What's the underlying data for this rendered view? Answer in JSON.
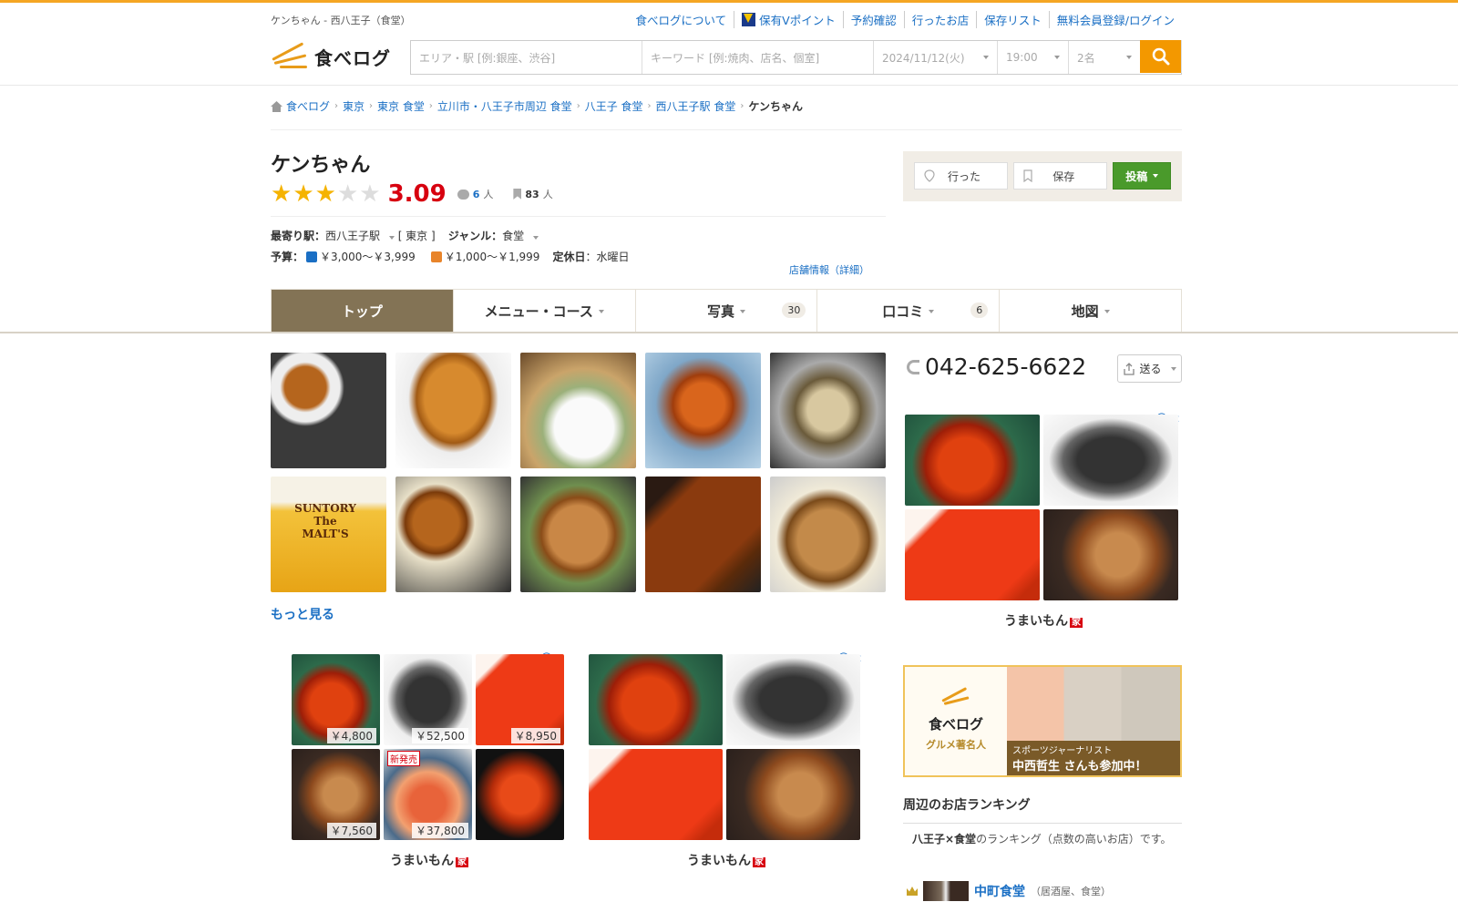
{
  "header": {
    "shop_path": "ケンちゃん - 西八王子（食堂）",
    "links": [
      "食べログについて",
      "保有Vポイント",
      "予約確認",
      "行ったお店",
      "保存リスト",
      "無料会員登録/ログイン"
    ],
    "logo_text": "食べログ"
  },
  "search": {
    "area_placeholder": "エリア・駅 [例:銀座、渋谷]",
    "keyword_placeholder": "キーワード [例:焼肉、店名、個室]",
    "date": "2024/11/12(火)",
    "time": "19:00",
    "people": "2名"
  },
  "breadcrumb": [
    "食べログ",
    "東京",
    "東京 食堂",
    "立川市・八王子市周辺 食堂",
    "八王子 食堂",
    "西八王子駅 食堂",
    "ケンちゃん"
  ],
  "shop": {
    "name": "ケンちゃん",
    "rating_stars": 3,
    "score": "3.09",
    "review_count": "6",
    "review_unit": "人",
    "save_count": "83",
    "save_unit": "人",
    "station_label": "最寄り駅：",
    "station": "西八王子駅",
    "station_area": "[ 東京 ]",
    "genre_label": "ジャンル：",
    "genre": "食堂",
    "budget_label": "予算：",
    "budget_night": "￥3,000～￥3,999",
    "budget_day": "￥1,000～￥1,999",
    "holiday_label": "定休日",
    "holiday": "：水曜日",
    "detail_link": "店舗情報（詳細）"
  },
  "actions": {
    "went": "行った",
    "save": "保存",
    "post": "投稿"
  },
  "tabs": [
    {
      "label": "トップ",
      "count": ""
    },
    {
      "label": "メニュー・コース",
      "count": ""
    },
    {
      "label": "写真",
      "count": "30"
    },
    {
      "label": "口コミ",
      "count": "6"
    },
    {
      "label": "地図",
      "count": ""
    }
  ],
  "photos": {
    "more_label": "もっと見る",
    "beer_text": "SUNTORY The MALT'S"
  },
  "ads": {
    "prices": [
      "￥4,800",
      "￥52,500",
      "￥8,950",
      "￥7,560",
      "￥37,800"
    ],
    "new_badge": "新発売",
    "brand": "うまいもん",
    "brand_badge": "家"
  },
  "sidebar": {
    "phone": "042-625-6622",
    "send_label": "送る",
    "banner_logo": "食べログ",
    "banner_sub": "グルメ著名人",
    "banner_caption1": "スポーツジャーナリスト",
    "banner_caption2": "中西哲生 さんも参加中！",
    "ranking_title": "周辺のお店ランキング",
    "ranking_desc_bold": "八王子×食堂",
    "ranking_desc": "のランキング（点数の高いお店）です。",
    "ranking_item_name": "中町食堂",
    "ranking_item_cat": "（居酒屋、食堂）"
  },
  "colors": {
    "accent": "#f39800",
    "score": "#d7000f",
    "tab_active": "#837355",
    "link": "#1a6fc4"
  }
}
